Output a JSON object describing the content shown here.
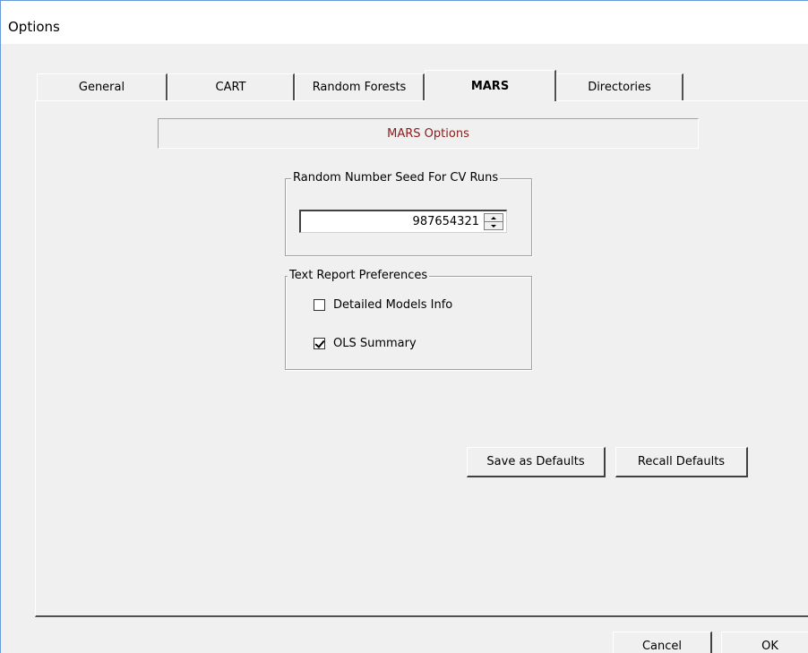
{
  "window": {
    "title": "Options"
  },
  "tabs": [
    {
      "label": "General",
      "active": false
    },
    {
      "label": "CART",
      "active": false
    },
    {
      "label": "Random Forests",
      "active": false
    },
    {
      "label": "MARS",
      "active": true
    },
    {
      "label": "Directories",
      "active": false
    }
  ],
  "mars_panel": {
    "header": "MARS Options",
    "header_color": "#8b1a1a",
    "seed_group": {
      "label": "Random Number Seed For CV Runs",
      "value": "987654321"
    },
    "report_group": {
      "label": "Text Report Preferences",
      "options": [
        {
          "label": "Detailed Models Info",
          "checked": false
        },
        {
          "label": "OLS Summary",
          "checked": true
        }
      ]
    },
    "buttons": {
      "save_defaults": "Save as Defaults",
      "recall_defaults": "Recall Defaults"
    }
  },
  "dialog_buttons": {
    "cancel": "Cancel",
    "ok": "OK"
  }
}
